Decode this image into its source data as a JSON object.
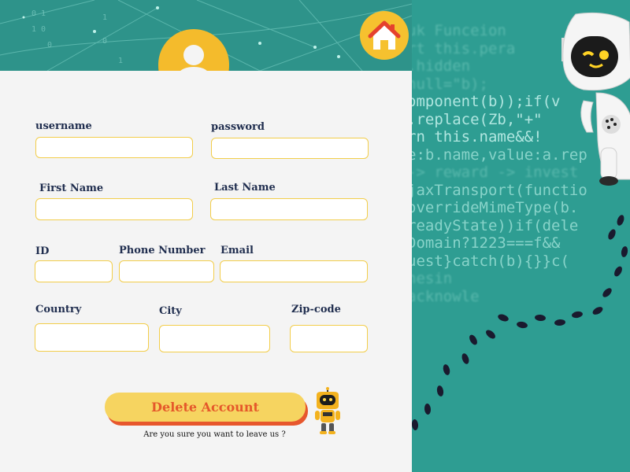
{
  "header": {
    "avatar_icon": "user-avatar-icon",
    "home_icon": "home-icon"
  },
  "form": {
    "username": {
      "label": "username",
      "value": ""
    },
    "password": {
      "label": "password",
      "value": ""
    },
    "first_name": {
      "label": "First Name",
      "value": ""
    },
    "last_name": {
      "label": "Last Name",
      "value": ""
    },
    "id": {
      "label": "ID",
      "value": ""
    },
    "phone": {
      "label": "Phone Number",
      "value": ""
    },
    "email": {
      "label": "Email",
      "value": ""
    },
    "country": {
      "label": "Country",
      "value": ""
    },
    "city": {
      "label": "City",
      "value": ""
    },
    "zip": {
      "label": "Zip-code",
      "value": ""
    }
  },
  "actions": {
    "delete_label": "Delete Account",
    "confirm_text": "Are you sure you want to leave us ?"
  },
  "decor": {
    "code_lines": [
      "uk Funceion",
      "rt this.pera",
      ".hidden",
      "null=\"b);",
      "omponent(b));if(v",
      ".replace(Zb,\"+\"",
      "rn this.name&&!",
      "e:b.name,value:a.rep",
      "-> reward -> invest",
      "jaxTransport(functio",
      "overrideMimeType(b.",
      "readyState))if(dele",
      "Domain?1223===f&&",
      "uest}catch(b){}}c(",
      "nesin ",
      "acknowle"
    ]
  },
  "colors": {
    "banner": "#2e938a",
    "accent_yellow": "#f6c12f",
    "input_border": "#f2cd4a",
    "delete_text": "#e5582a",
    "label_navy": "#1f2d4e"
  }
}
